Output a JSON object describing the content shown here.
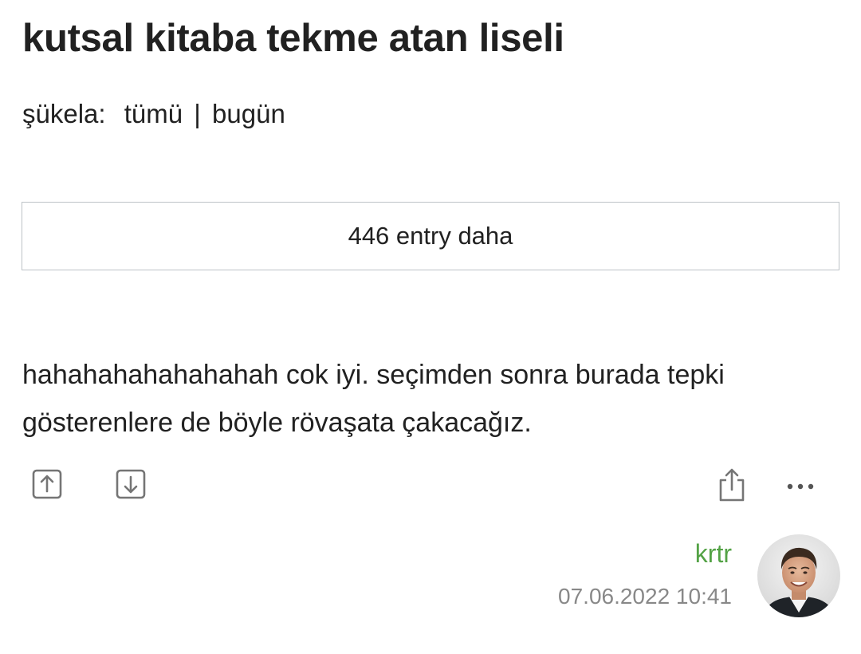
{
  "topic": {
    "title": "kutsal kitaba tekme atan liseli"
  },
  "filter": {
    "label": "şükela:",
    "all": "tümü",
    "separator": "|",
    "today": "bugün"
  },
  "more_entries": {
    "label": "446 entry daha"
  },
  "entry": {
    "content": "hahahahahahahahah cok iyi. seçimden sonra burada tepki gösterenlere de böyle rövaşata çakacağız.",
    "author": "krtr",
    "date": "07.06.2022 10:41"
  },
  "icons": {
    "upvote": "arrow-up-box-icon",
    "downvote": "arrow-down-box-icon",
    "share": "share-icon",
    "more": "more-dots-icon"
  },
  "colors": {
    "text": "#212121",
    "author": "#53a245",
    "date": "#888888",
    "border": "#bdc3c7",
    "icon": "#757575"
  }
}
